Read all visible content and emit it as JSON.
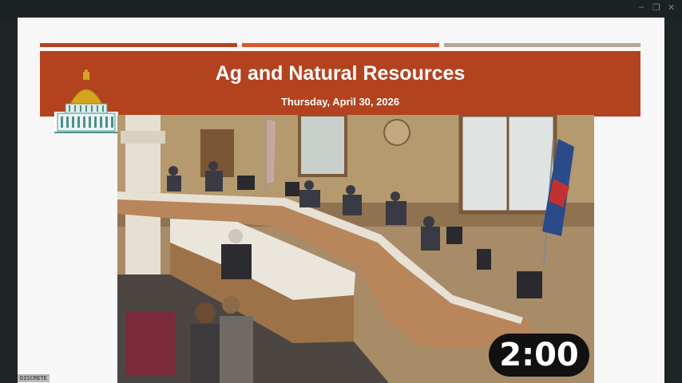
{
  "window": {
    "minimize_glyph": "–",
    "restore_glyph": "❐",
    "close_glyph": "✕"
  },
  "slide": {
    "title": "Ag and Natural Resources",
    "date": "Thursday, April 30, 2026",
    "stripe_colors": [
      "#b3431e",
      "#d8582a",
      "#b3a899"
    ],
    "banner_color": "#b3431e",
    "logo_icon": "capitol-dome-icon"
  },
  "video": {
    "description_icon": "hearing-room-video"
  },
  "timer": {
    "value": "2:00"
  },
  "badge": {
    "text": "DISCRETE"
  }
}
